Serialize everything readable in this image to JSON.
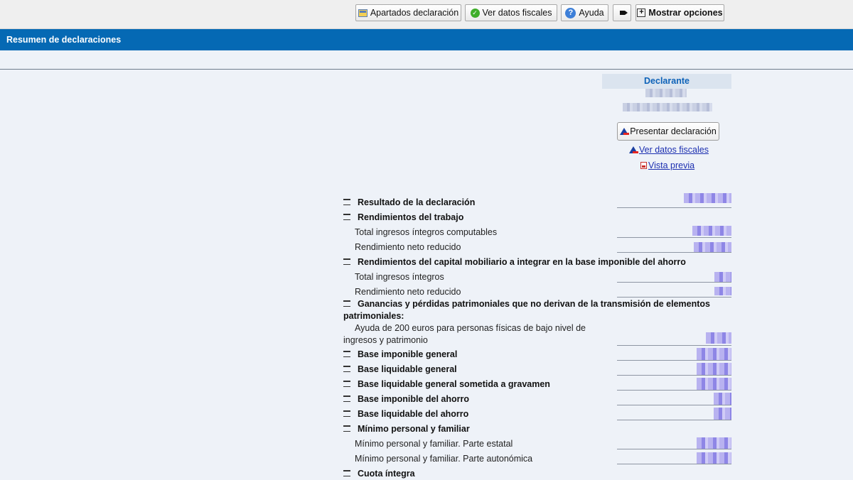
{
  "toolbar": {
    "apartados": "Apartados declaración",
    "ver_datos": "Ver datos fiscales",
    "ayuda": "Ayuda",
    "mostrar": "Mostrar opciones"
  },
  "title": "Resumen de declaraciones",
  "declarante": {
    "heading": "Declarante",
    "presentar_button": "Presentar declaración",
    "ver_datos_link": "Ver datos fiscales",
    "vista_previa_link": "Vista previa"
  },
  "summary": [
    {
      "label": "Resultado de la declaración",
      "kind": "heading"
    },
    {
      "label": "Rendimientos del trabajo",
      "kind": "heading"
    },
    {
      "label": "Total ingresos íntegros computables",
      "kind": "item"
    },
    {
      "label": "Rendimiento neto reducido",
      "kind": "item"
    },
    {
      "label": "Rendimientos del capital mobiliario a integrar en la base imponible del ahorro",
      "kind": "heading"
    },
    {
      "label": "Total ingresos íntegros",
      "kind": "item"
    },
    {
      "label": "Rendimiento neto reducido",
      "kind": "item"
    },
    {
      "label": "Ganancias y pérdidas patrimoniales que no derivan de la transmisión de elementos",
      "label2": "patrimoniales:",
      "kind": "heading"
    },
    {
      "label": "Ayuda de 200 euros para personas físicas de bajo nivel de",
      "label2": "ingresos y patrimonio",
      "kind": "item"
    },
    {
      "label": "Base imponible general",
      "kind": "heading"
    },
    {
      "label": "Base liquidable general",
      "kind": "heading"
    },
    {
      "label": "Base liquidable general sometida a gravamen",
      "kind": "heading"
    },
    {
      "label": "Base imponible del ahorro",
      "kind": "heading"
    },
    {
      "label": "Base liquidable del ahorro",
      "kind": "heading"
    },
    {
      "label": "Mínimo personal y familiar",
      "kind": "heading"
    },
    {
      "label": "Mínimo personal y familiar. Parte estatal",
      "kind": "item"
    },
    {
      "label": "Mínimo personal y familiar. Parte autonómica",
      "kind": "item"
    },
    {
      "label": "Cuota íntegra",
      "kind": "heading"
    }
  ]
}
